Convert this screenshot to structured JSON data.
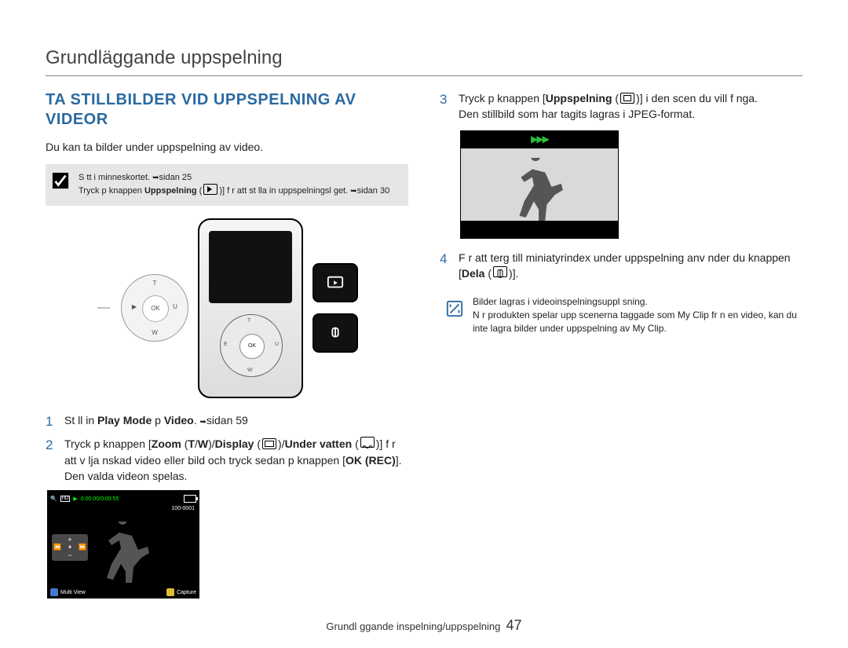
{
  "header": {
    "title": "Grundläggande uppspelning"
  },
  "left": {
    "section_title": "TA STILLBILDER VID UPPSPELNING AV VIDEOR",
    "intro": "Du kan ta bilder under uppspelning av video.",
    "graybox": {
      "line1_a": "S tt i minneskortet. ",
      "line1_b": "sidan 25",
      "line2_a": "Tryck p  knappen ",
      "line2_bold": "Uppspelning",
      "line2_b": " (",
      "line2_c": ")] f r att st lla in uppspelningsl get. ",
      "line2_d": "sidan 30"
    },
    "dpad": {
      "t": "T",
      "w": "W",
      "ok": "OK",
      "left_icon": "▶",
      "right_icon": "U"
    },
    "steps12": {
      "s1_a": "St ll in ",
      "s1_b1": "Play Mode",
      "s1_mid": " p  ",
      "s1_b2": "Video",
      "s1_c": ".  ",
      "s1_d": "sidan 59",
      "s2_a": "Tryck p  knappen [",
      "s2_b1": "Zoom",
      "s2_mid1": " (",
      "s2_b2": "T",
      "s2_slash1": "/",
      "s2_b3": "W",
      "s2_mid2": ")/",
      "s2_b4": "Display",
      "s2_mid3": " (",
      "s2_mid4": ")/",
      "s2_b5": "Under vatten",
      "s2_c": " (",
      "s2_d": ")] f r att v lja  nskad video eller bild och tryck sedan p  knappen [",
      "s2_b6": "OK (REC)",
      "s2_e": "].",
      "s2_f": "Den valda videon spelas."
    },
    "lcd": {
      "timecode": "0:00:00/0:00:55",
      "clip": "100-0001",
      "multi": "Multi View",
      "capture": "Capture",
      "plus": "+",
      "minus": "−"
    }
  },
  "right": {
    "s3_a": "Tryck p  knappen [",
    "s3_b": "Uppspelning",
    "s3_c": " (",
    "s3_d": ")] i den scen du vill f nga.",
    "s3_e": "Den stillbild som har tagits lagras i JPEG-format.",
    "s4_a": "F r att  terg  till miniatyrindex under uppspelning anv nder du knappen [",
    "s4_b": "Dela",
    "s4_c": " (",
    "s4_d": ")].",
    "note_l1": "Bilder lagras i videoinspelningsuppl sning.",
    "note_l2": "N r produkten spelar upp scenerna taggade som  My Clip  fr n en video, kan du inte lagra bilder under uppspelning av My Clip."
  },
  "footer": {
    "section": "Grundl ggande inspelning/uppspelning",
    "page": "47"
  }
}
